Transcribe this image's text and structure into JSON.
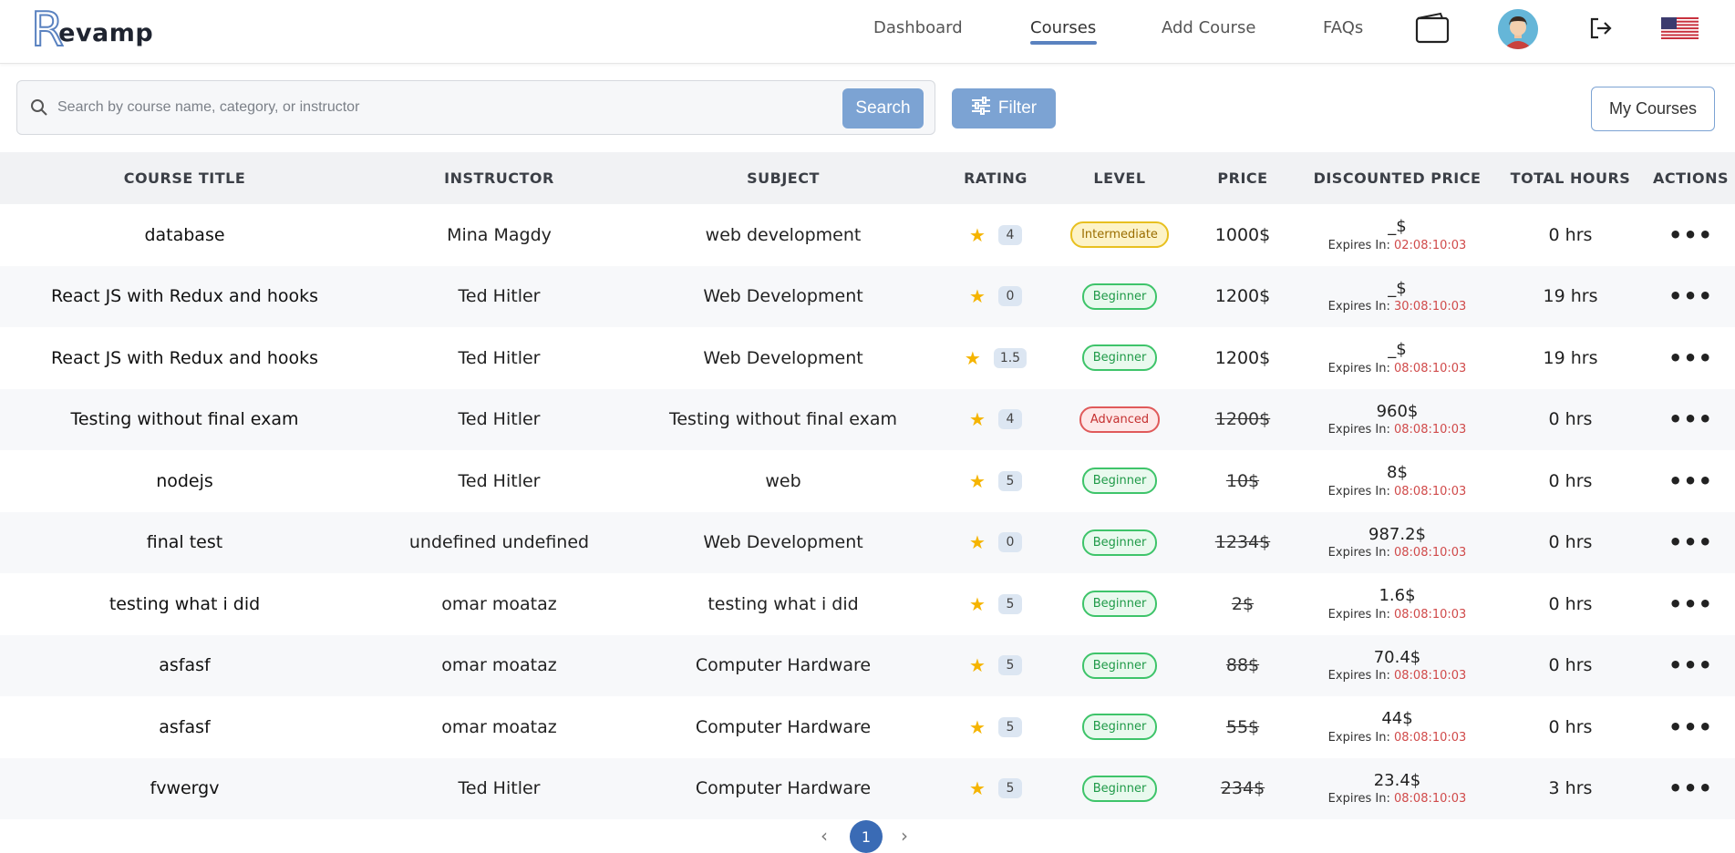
{
  "app": {
    "logo_letter": "R",
    "logo_text": "evamp"
  },
  "nav": {
    "dashboard": "Dashboard",
    "courses": "Courses",
    "add_course": "Add Course",
    "faqs": "FAQs"
  },
  "icons": {
    "wallet": "wallet-icon",
    "avatar": "avatar",
    "logout": "logout-icon",
    "flag": "us-flag-icon",
    "search": "search-icon",
    "filter": "sliders-icon",
    "actions": "more-horizontal-icon"
  },
  "colors": {
    "accent": "#5a82c0",
    "button": "#7ca3d3",
    "page_active": "#3a6bb5"
  },
  "search": {
    "placeholder": "Search by course name, category, or instructor",
    "value": "",
    "button": "Search"
  },
  "filter_label": "Filter",
  "my_courses_label": "My Courses",
  "table": {
    "headers": [
      "COURSE TITLE",
      "INSTRUCTOR",
      "SUBJECT",
      "RATING",
      "LEVEL",
      "PRICE",
      "DISCOUNTED PRICE",
      "TOTAL HOURS",
      "ACTIONS"
    ],
    "rows": [
      {
        "title": "database",
        "instructor": "Mina Magdy",
        "subject": "web development",
        "rating": "4",
        "level": "Intermediate",
        "price": "1000$",
        "discounted": "_$",
        "expires_label": "Expires In: ",
        "expires": "02:08:10:03",
        "hours": "0 hrs"
      },
      {
        "title": "React JS with Redux and hooks",
        "instructor": "Ted Hitler",
        "subject": "Web Development",
        "rating": "0",
        "level": "Beginner",
        "price": "1200$",
        "discounted": "_$",
        "expires_label": "Expires In: ",
        "expires": "30:08:10:03",
        "hours": "19 hrs"
      },
      {
        "title": "React JS with Redux and hooks",
        "instructor": "Ted Hitler",
        "subject": "Web Development",
        "rating": "1.5",
        "level": "Beginner",
        "price": "1200$",
        "discounted": "_$",
        "expires_label": "Expires In: ",
        "expires": "08:08:10:03",
        "hours": "19 hrs"
      },
      {
        "title": "Testing without final exam",
        "instructor": "Ted Hitler",
        "subject": "Testing without final exam",
        "rating": "4",
        "level": "Advanced",
        "price": "1200$",
        "discounted": "960$",
        "expires_label": "Expires In: ",
        "expires": "08:08:10:03",
        "hours": "0 hrs"
      },
      {
        "title": "nodejs",
        "instructor": "Ted Hitler",
        "subject": "web",
        "rating": "5",
        "level": "Beginner",
        "price": "10$",
        "discounted": "8$",
        "expires_label": "Expires In: ",
        "expires": "08:08:10:03",
        "hours": "0 hrs"
      },
      {
        "title": "final test",
        "instructor": "undefined undefined",
        "subject": "Web Development",
        "rating": "0",
        "level": "Beginner",
        "price": "1234$",
        "discounted": "987.2$",
        "expires_label": "Expires In: ",
        "expires": "08:08:10:03",
        "hours": "0 hrs"
      },
      {
        "title": "testing what i did",
        "instructor": "omar moataz",
        "subject": "testing what i did",
        "rating": "5",
        "level": "Beginner",
        "price": "2$",
        "discounted": "1.6$",
        "expires_label": "Expires In: ",
        "expires": "08:08:10:03",
        "hours": "0 hrs"
      },
      {
        "title": "asfasf",
        "instructor": "omar moataz",
        "subject": "Computer Hardware",
        "rating": "5",
        "level": "Beginner",
        "price": "88$",
        "discounted": "70.4$",
        "expires_label": "Expires In: ",
        "expires": "08:08:10:03",
        "hours": "0 hrs"
      },
      {
        "title": "asfasf",
        "instructor": "omar moataz",
        "subject": "Computer Hardware",
        "rating": "5",
        "level": "Beginner",
        "price": "55$",
        "discounted": "44$",
        "expires_label": "Expires In: ",
        "expires": "08:08:10:03",
        "hours": "0 hrs"
      },
      {
        "title": "fvwergv",
        "instructor": "Ted Hitler",
        "subject": "Computer Hardware",
        "rating": "5",
        "level": "Beginner",
        "price": "234$",
        "discounted": "23.4$",
        "expires_label": "Expires In: ",
        "expires": "08:08:10:03",
        "hours": "3 hrs"
      }
    ],
    "actions_glyph": "•••",
    "star_glyph": "★"
  },
  "pagination": {
    "prev": "‹",
    "current": "1",
    "next": "›"
  }
}
